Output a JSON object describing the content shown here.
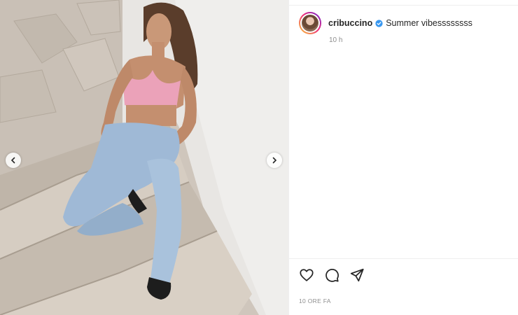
{
  "post": {
    "username": "cribuccino",
    "verified": true,
    "caption": "Summer vibessssssss",
    "time_relative": "10 h",
    "date_label": "10 ORE FA"
  },
  "icons": {
    "prev": "chevron-left-icon",
    "next": "chevron-right-icon",
    "like": "heart-icon",
    "comment": "comment-bubble-icon",
    "share": "paper-plane-icon",
    "verified": "verified-badge-icon"
  },
  "colors": {
    "verified_blue": "#3897f0",
    "text": "#262626",
    "muted": "#8e8e8e"
  }
}
